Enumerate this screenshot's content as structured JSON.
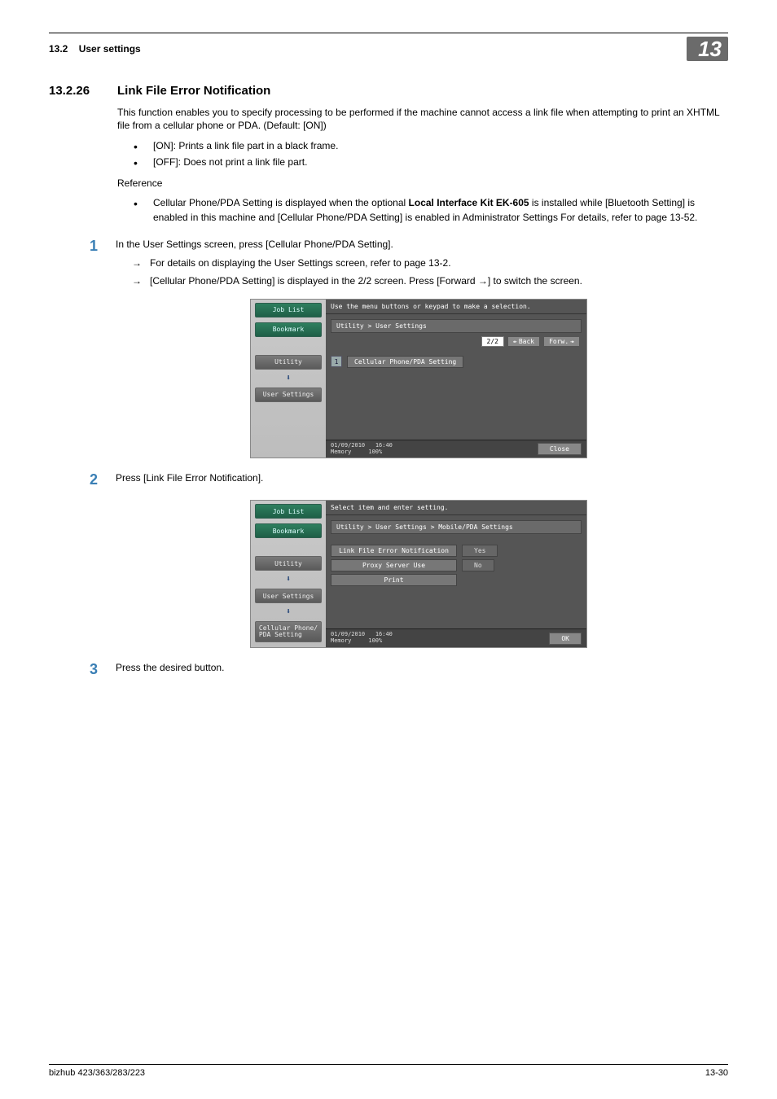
{
  "header": {
    "section_ref": "13.2",
    "section_label": "User settings",
    "chapter_number": "13"
  },
  "section": {
    "number": "13.2.26",
    "title": "Link File Error Notification"
  },
  "intro": "This function enables you to specify processing to be performed if the machine cannot access a link file when attempting to print an XHTML file from a cellular phone or PDA. (Default: [ON])",
  "options": [
    "[ON]: Prints a link file part in a black frame.",
    "[OFF]: Does not print a link file part."
  ],
  "reference_label": "Reference",
  "reference_items": [
    {
      "pre": "Cellular Phone/PDA Setting is displayed when the optional ",
      "bold": "Local Interface Kit EK-605",
      "post": " is installed while [Bluetooth Setting] is enabled in this machine and [Cellular Phone/PDA Setting] is enabled in Administrator Settings For details, refer to page 13-52."
    }
  ],
  "steps": [
    {
      "n": "1",
      "text": "In the User Settings screen, press [Cellular Phone/PDA Setting].",
      "subs": [
        "For details on displaying the User Settings screen, refer to page 13-2.",
        "[Cellular Phone/PDA Setting] is displayed in the 2/2 screen. Press [Forward →] to switch the screen."
      ]
    },
    {
      "n": "2",
      "text": "Press [Link File Error Notification].",
      "subs": []
    },
    {
      "n": "3",
      "text": "Press the desired button.",
      "subs": []
    }
  ],
  "device1": {
    "topmsg": "Use the menu buttons or keypad to make a selection.",
    "crumb": "Utility > User Settings",
    "page": "2/2",
    "back": "Back",
    "forward": "Forw.",
    "side": {
      "joblist": "Job List",
      "bookmark": "Bookmark",
      "utility": "Utility",
      "usersettings": "User Settings"
    },
    "opt_num": "1",
    "opt_label": "Cellular Phone/PDA Setting",
    "date": "01/09/2010",
    "time": "16:40",
    "mem_label": "Memory",
    "mem_val": "100%",
    "close": "Close"
  },
  "device2": {
    "topmsg": "Select item and enter setting.",
    "crumb": "Utility > User Settings > Mobile/PDA Settings",
    "side": {
      "joblist": "Job List",
      "bookmark": "Bookmark",
      "utility": "Utility",
      "usersettings": "User Settings",
      "cellpda": "Cellular Phone/\nPDA Setting"
    },
    "rows": [
      {
        "label": "Link File Error Notification",
        "value": "Yes"
      },
      {
        "label": "Proxy Server Use",
        "value": "No"
      },
      {
        "label": "Print",
        "value": ""
      }
    ],
    "date": "01/09/2010",
    "time": "16:40",
    "mem_label": "Memory",
    "mem_val": "100%",
    "ok": "OK"
  },
  "footer": {
    "left": "bizhub 423/363/283/223",
    "right": "13-30"
  }
}
